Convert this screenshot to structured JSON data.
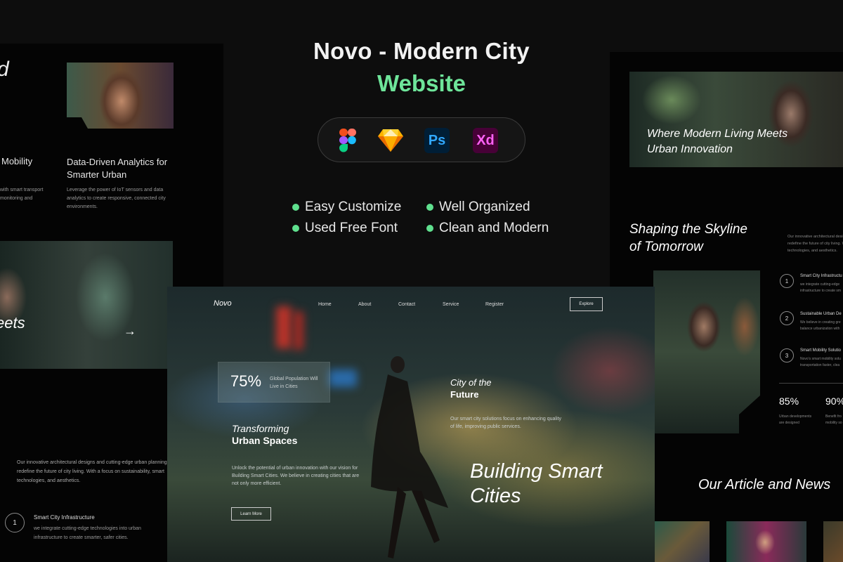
{
  "header": {
    "title_line1": "Novo - Modern City",
    "title_line2": "Website",
    "accent_color": "#6ee59a"
  },
  "tools": [
    {
      "name": "figma-icon",
      "label": ""
    },
    {
      "name": "sketch-icon",
      "label": ""
    },
    {
      "name": "photoshop-icon",
      "label": "Ps"
    },
    {
      "name": "xd-icon",
      "label": "Xd"
    }
  ],
  "features": [
    "Easy Customize",
    "Well Organized",
    "Used Free Font",
    "Clean and Modern"
  ],
  "left": {
    "heading_fragment": "d",
    "mobility_title": "Mobility",
    "mobility_text_1": "with smart transport",
    "mobility_text_2": "monitoring and",
    "analytics_title_1": "Data-Driven Analytics for",
    "analytics_title_2": "Smarter Urban",
    "analytics_text_1": "Leverage the power of IoT sensors and data",
    "analytics_text_2": "analytics to create responsive, connected city",
    "analytics_text_3": "environments.",
    "meets": "eets",
    "arrow": "→",
    "about_1": "Our innovative architectural designs and cutting-edge urban planning",
    "about_2": "redefine the future of city living. With a focus on sustainability, smart",
    "about_3": "technologies, and aesthetics.",
    "step_number": "1",
    "step_title": "Smart City Infrastructure",
    "step_text_1": "we integrate cutting-edge technologies into urban",
    "step_text_2": "infrastructure to create smarter, safer cities."
  },
  "right": {
    "hero_1": "Where Modern Living Meets",
    "hero_2": "Urban Innovation",
    "skyline_1": "Shaping the Skyline",
    "skyline_2": "of Tomorrow",
    "skyline_text_1": "Our innovative architectural desig",
    "skyline_text_2": "redefine the future of city living. W",
    "skyline_text_3": "technologies, and aesthetics.",
    "items": [
      {
        "num": "1",
        "title": "Smart City Infrastructu",
        "text_1": "we integrate cutting-edge",
        "text_2": "infrastructure to create sm"
      },
      {
        "num": "2",
        "title": "Sustainable Urban De",
        "text_1": "We believe in creating gre",
        "text_2": "balance urbanization with"
      },
      {
        "num": "3",
        "title": "Smart Mobility Solutio",
        "text_1": "Novo's smart mobility solu",
        "text_2": "transportation faster, clea"
      }
    ],
    "stat1_value": "85%",
    "stat1_text_1": "Urban developments",
    "stat1_text_2": "are designed",
    "stat2_value": "90%",
    "stat2_text_1": "Benefit fro",
    "stat2_text_2": "mobility so",
    "articles": "Our Article and News"
  },
  "hero": {
    "logo": "Novo",
    "nav": [
      "Home",
      "About",
      "Contact",
      "Service",
      "Register"
    ],
    "explore": "Explore",
    "stat_value": "75%",
    "stat_text_1": "Global Population Will",
    "stat_text_2": "Live in Cities",
    "city_1": "City of the",
    "city_2": "Future",
    "city_text_1": "Our smart city solutions focus on enhancing quality",
    "city_text_2": "of life, improving public services.",
    "transform_1": "Transforming",
    "transform_2": "Urban Spaces",
    "body_1": "Unlock the potential of urban innovation with our vision for",
    "body_2": "Building Smart Cities. We believe in creating cities that are",
    "body_3": "not only more efficient.",
    "learn_more": "Learn More",
    "big_1": "Building Smart",
    "big_2": "Cities"
  }
}
